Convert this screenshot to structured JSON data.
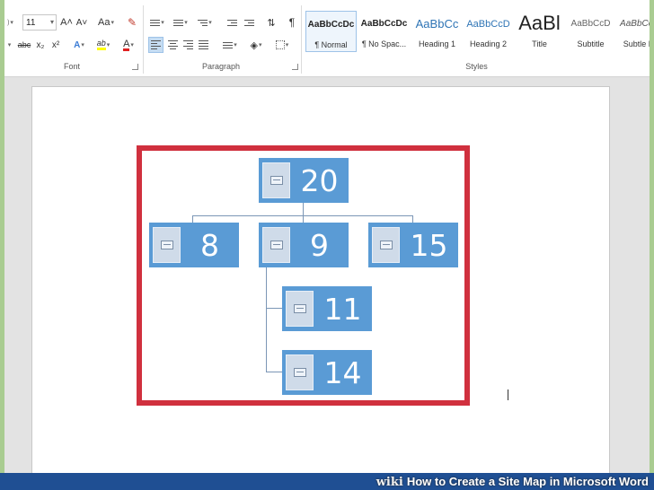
{
  "ribbon": {
    "font_size": "11",
    "font_group_label": "Font",
    "paragraph_group_label": "Paragraph",
    "styles_group_label": "Styles",
    "buttons": {
      "grow_font": "A˄",
      "shrink_font": "A˅",
      "change_case": "Aa",
      "strikethrough": "abc",
      "subscript": "x₂",
      "superscript": "x²",
      "text_effects": "A",
      "highlight": "ab",
      "font_color": "A",
      "pilcrow": "¶"
    },
    "styles": [
      {
        "sample": "AaBbCcDc",
        "name": "¶ Normal"
      },
      {
        "sample": "AaBbCcDc",
        "name": "¶ No Spac..."
      },
      {
        "sample": "AaBbCc",
        "name": "Heading 1"
      },
      {
        "sample": "AaBbCcD",
        "name": "Heading 2"
      },
      {
        "sample": "AaBl",
        "name": "Title"
      },
      {
        "sample": "AaBbCcD",
        "name": "Subtitle"
      },
      {
        "sample": "AaBbCcDc",
        "name": "Subtle Em"
      }
    ]
  },
  "diagram": {
    "root": "20",
    "level1": [
      "8",
      "9",
      "15"
    ],
    "children_of_9": [
      "11",
      "14"
    ]
  },
  "watermark": {
    "brand": "wiki",
    "title": "How to Create a Site Map in Microsoft Word"
  },
  "colors": {
    "node_fill": "#5a9bd5",
    "highlight_box": "#d0303e",
    "bottom_bar": "#1f4f93"
  }
}
